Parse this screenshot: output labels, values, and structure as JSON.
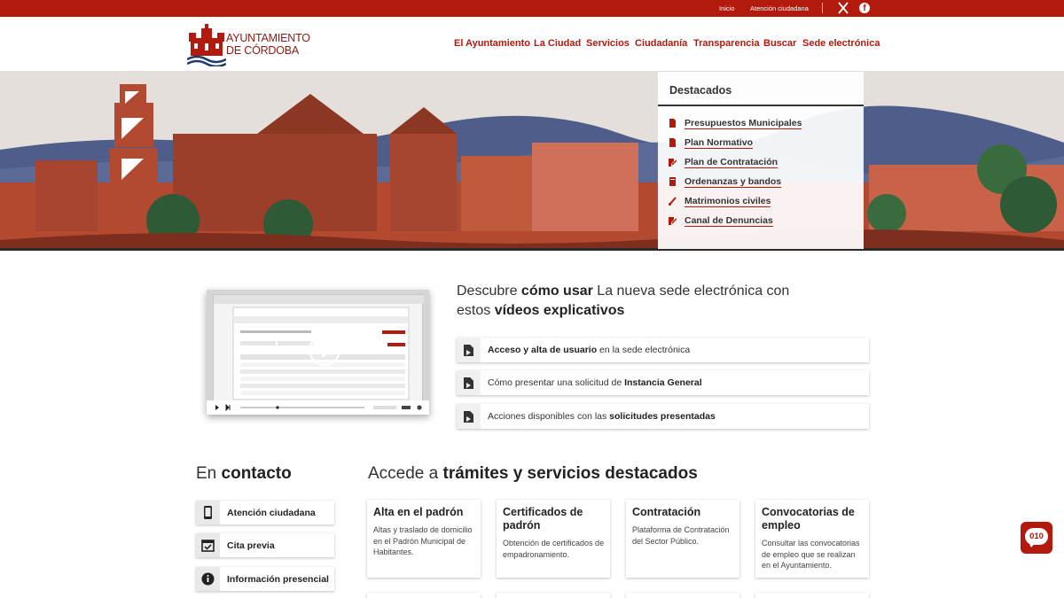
{
  "topbar": {
    "links": [
      "Inicio",
      "Atención ciudadana"
    ],
    "social": [
      "x-icon",
      "facebook-icon"
    ]
  },
  "logo": {
    "line1": "AYUNTAMIENTO",
    "line2": "DE CÓRDOBA"
  },
  "nav": [
    "El Ayuntamiento",
    "La Ciudad",
    "Servicios",
    "Ciudadanía",
    "Transparencia",
    "Buscar",
    "Sede electrónica"
  ],
  "destacados": {
    "title": "Destacados",
    "items": [
      {
        "label": "Presupuestos Municipales",
        "icon": "document-icon"
      },
      {
        "label": "Plan Normativo",
        "icon": "document-icon"
      },
      {
        "label": "Plan de Contratación",
        "icon": "edit-document-icon"
      },
      {
        "label": "Ordenanzas y bandos",
        "icon": "book-icon"
      },
      {
        "label": "Matrimonios civiles",
        "icon": "brush-icon"
      },
      {
        "label": "Canal de Denuncias",
        "icon": "edit-document-icon"
      }
    ]
  },
  "video_section": {
    "heading": {
      "p1": "Descubre ",
      "b1": "cómo usar",
      "p2": " La nueva sede electrónica con estos ",
      "b2": "vídeos explicativos"
    },
    "items": [
      {
        "b": "Acceso y alta de usuario",
        "rest": " en la sede electrónica"
      },
      {
        "pre": "Cómo presentar una solicitud de ",
        "b": "Instancia General"
      },
      {
        "pre": "Acciones disponibles con las ",
        "b": "solicitudes presentadas"
      }
    ]
  },
  "contact": {
    "title_pre": "En ",
    "title_b": "contacto",
    "items": [
      {
        "label": "Atención ciudadana",
        "icon": "phone-icon"
      },
      {
        "label": "Cita previa",
        "icon": "calendar-check-icon"
      },
      {
        "label": "Información presencial",
        "icon": "info-icon"
      }
    ]
  },
  "services": {
    "title_pre": "Accede a ",
    "title_b": "trámites y servicios destacados",
    "cards": [
      {
        "title": "Alta en el padrón",
        "desc": "Altas y traslado de domicilio en el Padrón Municipal de Habitantes."
      },
      {
        "title": "Certificados de padrón",
        "desc": "Obtención de certificados de empadronamiento."
      },
      {
        "title": "Contratación",
        "desc": "Plataforma de Contratación del Sector Público."
      },
      {
        "title": "Convocatorias de empleo",
        "desc": "Consultar las convocatorias de empleo que se realizan en el Ayuntamiento."
      }
    ]
  },
  "badge": "010",
  "colors": {
    "brand": "#b11a0d",
    "text": "#222222"
  }
}
